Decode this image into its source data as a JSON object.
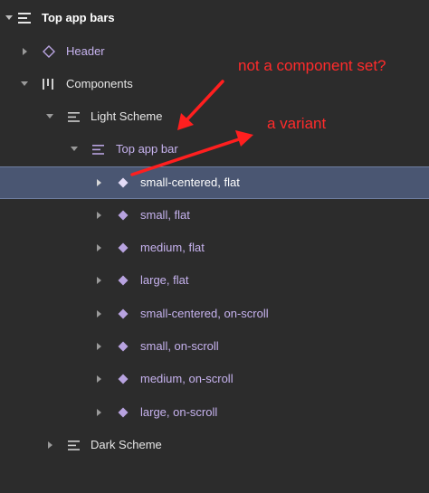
{
  "tree": {
    "root": {
      "label": "Top app bars",
      "icon": "frame-icon"
    },
    "header": {
      "label": "Header",
      "icon": "component-instance-icon"
    },
    "components": {
      "label": "Components",
      "icon": "auto-layout-icon"
    },
    "light_scheme": {
      "label": "Light Scheme",
      "icon": "frame-icon"
    },
    "top_app_bar": {
      "label": "Top app bar",
      "icon": "frame-icon"
    },
    "variants": [
      {
        "label": "small-centered, flat",
        "icon": "component-icon",
        "selected": true
      },
      {
        "label": "small, flat",
        "icon": "component-icon"
      },
      {
        "label": "medium, flat",
        "icon": "component-icon"
      },
      {
        "label": "large, flat",
        "icon": "component-icon"
      },
      {
        "label": "small-centered, on-scroll",
        "icon": "component-icon"
      },
      {
        "label": "small, on-scroll",
        "icon": "component-icon"
      },
      {
        "label": "medium, on-scroll",
        "icon": "component-icon"
      },
      {
        "label": "large, on-scroll",
        "icon": "component-icon"
      }
    ],
    "dark_scheme": {
      "label": "Dark Scheme",
      "icon": "frame-icon"
    }
  },
  "annotations": {
    "not_component_set": "not a component set?",
    "a_variant": "a variant"
  },
  "colors": {
    "background": "#2c2c2c",
    "selected_row": "#4a5672",
    "purple_text": "#c6b2ee",
    "annotation_red": "#ff2b2b"
  }
}
